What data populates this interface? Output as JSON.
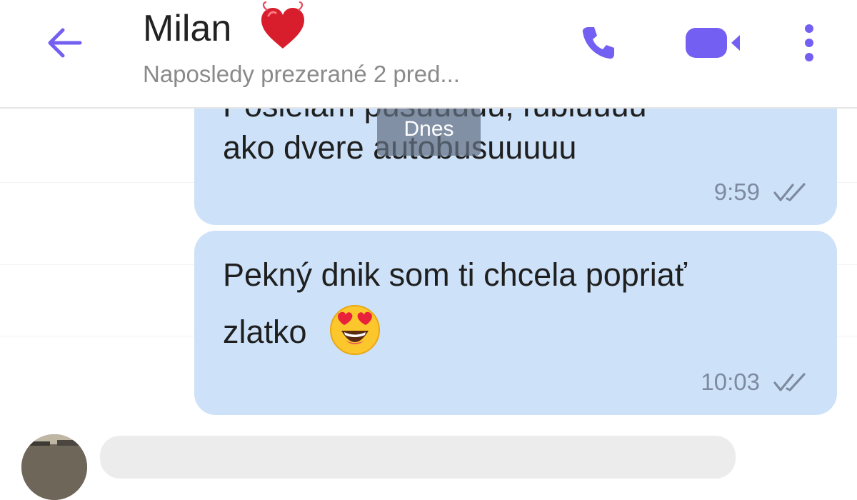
{
  "header": {
    "contact_name": "Milan",
    "status": "Naposledy prezerané 2 pred...",
    "accent_color": "#7360f2",
    "icons": [
      "back-arrow-icon",
      "heart-icon",
      "phone-icon",
      "video-camera-icon",
      "more-vert-icon"
    ]
  },
  "date_chip": "Dnes",
  "messages": [
    {
      "direction": "outgoing",
      "cut_text": "Posielam pusuuuuu, ľúbiuuuu",
      "text": "ako dvere autobusuuuuu",
      "time": "9:59",
      "status": "delivered"
    },
    {
      "direction": "outgoing",
      "text_line1": "Pekný dnik som ti chcela popriať",
      "text_line2": "zlatko",
      "emoji": "heart-eyes-emoji",
      "time": "10:03",
      "status": "delivered"
    }
  ],
  "colors": {
    "outgoing_bubble": "#cde2f9",
    "incoming_bubble": "#ececec",
    "check": "#7d8aa0"
  }
}
